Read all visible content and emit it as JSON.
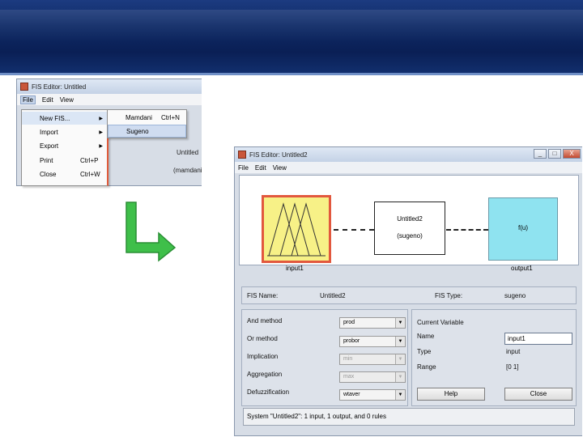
{
  "window1": {
    "title": "FIS Editor: Untitled",
    "menu": [
      "File",
      "Edit",
      "View"
    ],
    "file_menu": [
      {
        "label": "New FIS...",
        "shortcut": "",
        "submenu": true
      },
      {
        "label": "Import",
        "shortcut": "",
        "submenu": true
      },
      {
        "label": "Export",
        "shortcut": "",
        "submenu": true
      },
      {
        "label": "Print",
        "shortcut": "Ctrl+P",
        "submenu": false
      },
      {
        "label": "Close",
        "shortcut": "Ctrl+W",
        "submenu": false
      }
    ],
    "new_fis_submenu": [
      {
        "label": "Mamdani",
        "shortcut": "Ctrl+N"
      },
      {
        "label": "Sugeno",
        "shortcut": ""
      }
    ],
    "side_text": [
      "Untitled",
      "(mamdani"
    ]
  },
  "window2": {
    "title": "FIS Editor: Untitled2",
    "buttons": {
      "minimize": "_",
      "maximize": "□",
      "close": "X"
    },
    "menu": [
      "File",
      "Edit",
      "View"
    ],
    "diagram": {
      "input_label": "input1",
      "system_name": "Untitled2",
      "system_type": "(sugeno)",
      "output_fn": "f(u)",
      "output_label": "output1"
    },
    "info": {
      "fis_name_label": "FIS Name:",
      "fis_name": "Untitled2",
      "fis_type_label": "FIS Type:",
      "fis_type": "sugeno"
    },
    "methods": [
      {
        "label": "And method",
        "value": "prod",
        "enabled": true
      },
      {
        "label": "Or method",
        "value": "probor",
        "enabled": true
      },
      {
        "label": "Implication",
        "value": "min",
        "enabled": false
      },
      {
        "label": "Aggregation",
        "value": "max",
        "enabled": false
      },
      {
        "label": "Defuzzification",
        "value": "wtaver",
        "enabled": true
      }
    ],
    "current_variable": {
      "heading": "Current Variable",
      "name_label": "Name",
      "name_value": "input1",
      "type_label": "Type",
      "type_value": "input",
      "range_label": "Range",
      "range_value": "[0 1]"
    },
    "help_button": "Help",
    "close_button": "Close",
    "status": "System \"Untitled2\": 1 input, 1 output, and 0 rules"
  },
  "colors": {
    "banner": "#0e2a66",
    "input_box": "#f7f187",
    "input_border": "#e2583e",
    "output_box": "#8fe3f0",
    "arrow": "#3fbf4a"
  }
}
